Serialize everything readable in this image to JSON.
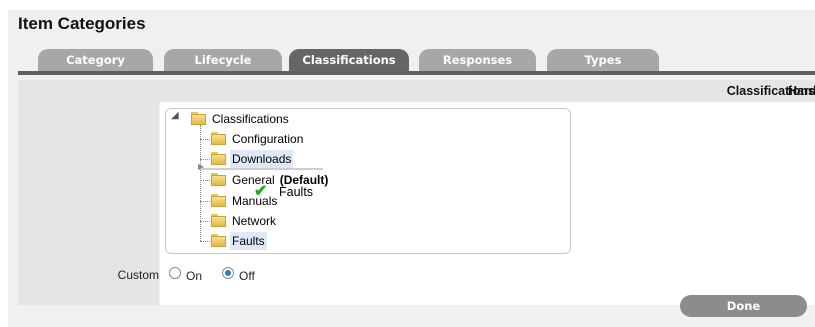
{
  "page": {
    "title": "Item Categories"
  },
  "tabs": [
    {
      "label": "Category",
      "active": false
    },
    {
      "label": "Lifecycle",
      "active": false
    },
    {
      "label": "Classifications",
      "active": true
    },
    {
      "label": "Responses",
      "active": false
    },
    {
      "label": "Types",
      "active": false
    }
  ],
  "row": {
    "label": "Classifications",
    "right_text": "Hardware"
  },
  "tree": {
    "root": "Classifications",
    "children": [
      {
        "label": "Configuration"
      },
      {
        "label": "Downloads",
        "selected": true
      },
      {
        "label": "General",
        "suffix": "(Default)"
      },
      {
        "label": "Manuals"
      },
      {
        "label": "Network"
      },
      {
        "label": "Faults",
        "selected": true
      }
    ],
    "drag_ghost": "Faults"
  },
  "custom": {
    "label": "Custom",
    "options": [
      "On",
      "Off"
    ],
    "selected": "Off"
  },
  "actions": {
    "done_label": "Done"
  },
  "colors": {
    "tab_inactive": "#a7a7a7",
    "tab_active": "#666666",
    "selected_node": "#dde9f7",
    "drop_check": "#22aa22"
  }
}
